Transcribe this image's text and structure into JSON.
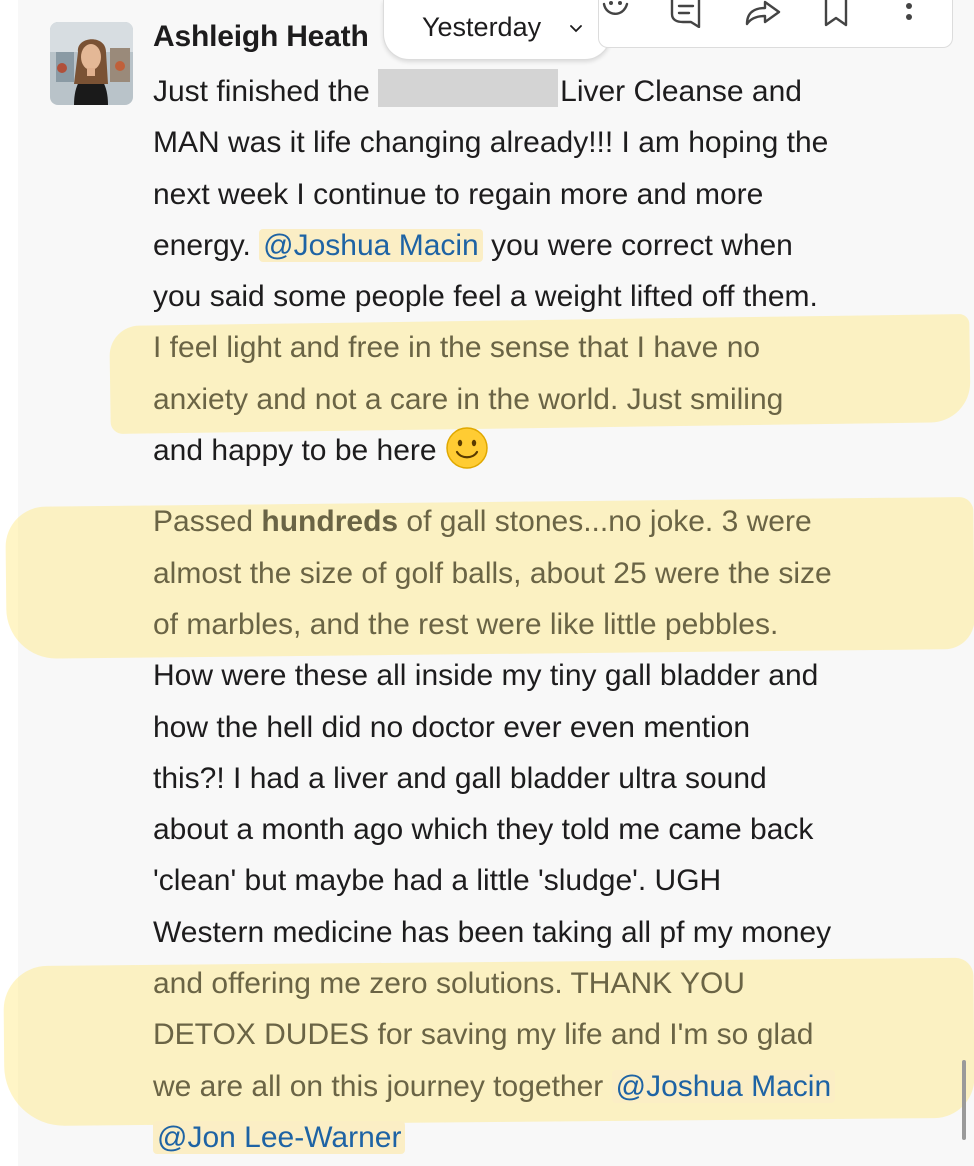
{
  "message": {
    "sender": "Ashleigh Heath",
    "date_label": "Yesterday",
    "lines": [
      {
        "a": "Just finished the",
        "b": "Liver Cleanse and"
      },
      {
        "t": "MAN was it life changing already!!!  I am hoping the"
      },
      {
        "t": "next week I continue to regain more and more"
      },
      {
        "a": "energy. ",
        "m": "@Joshua Macin",
        "b": " you were correct when"
      },
      {
        "t": "you said some people feel a weight lifted off them."
      },
      {
        "t": "I feel light and free in the sense that I have no"
      },
      {
        "t": "anxiety and not a care in the world.  Just smiling"
      },
      {
        "t": "and happy to be here"
      },
      {
        "a": "Passed ",
        "bold": "hundreds",
        "b": " of gall stones...no joke.  3 were"
      },
      {
        "t": "almost the size of golf balls, about 25 were the size"
      },
      {
        "t": "of marbles, and the rest were like little pebbles."
      },
      {
        "t": "How were these all inside my tiny gall bladder and"
      },
      {
        "t": "how the hell did no doctor ever even mention"
      },
      {
        "t": "this?!  I had a liver and gall bladder ultra sound"
      },
      {
        "t": "about a month ago which they told me came back"
      },
      {
        "t": "'clean' but maybe had a little 'sludge'.  UGH"
      },
      {
        "t": "Western medicine has been taking all pf my money"
      },
      {
        "t": "and offering me zero solutions.  THANK YOU"
      },
      {
        "t": "DETOX DUDES for saving my life and I'm so glad"
      },
      {
        "a": "we are all on this journey together ",
        "m": "@Joshua Macin"
      },
      {
        "m": "@Jon Lee-Warner"
      }
    ]
  },
  "icons": {
    "actions": [
      "add-reaction-icon",
      "reply-in-thread-icon",
      "forward-icon",
      "bookmark-icon",
      "more-actions-icon"
    ],
    "date_chevron": "chevron-down-icon",
    "emoji": "slightly-smiling-face-emoji"
  },
  "colors": {
    "mention_bg": "#fbeec5",
    "mention_text": "#1e63a4",
    "highlighter": "#ffe878",
    "panel_bg": "#f8f8f8"
  }
}
